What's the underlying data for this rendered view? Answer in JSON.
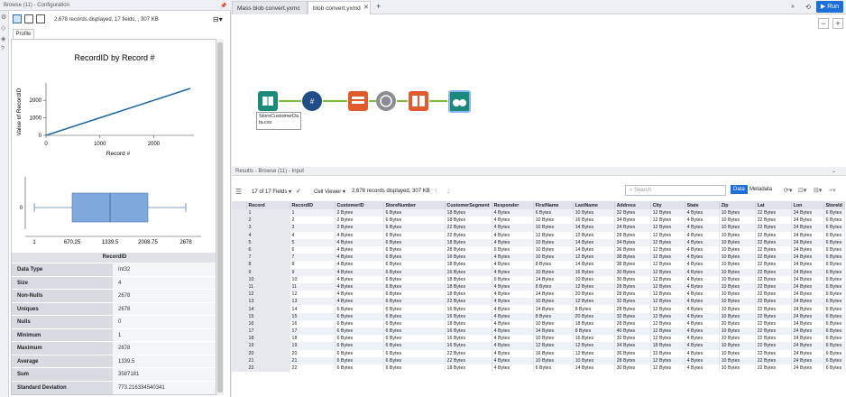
{
  "left_panel": {
    "header": "Browse (11) - Configuration",
    "record_info": "2,678 records displayed, 17 fields, , 307 KB",
    "profile_tab": "Profile",
    "chart_title": "RecordID by Record #",
    "stats_title": "RecordID",
    "stats": [
      {
        "k": "Data Type",
        "v": "Int32"
      },
      {
        "k": "Size",
        "v": "4"
      },
      {
        "k": "Non-Nulls",
        "v": "2678"
      },
      {
        "k": "Uniques",
        "v": "2678"
      },
      {
        "k": "Nulls",
        "v": "0"
      },
      {
        "k": "Minimum",
        "v": "1"
      },
      {
        "k": "Maximum",
        "v": "2678"
      },
      {
        "k": "Average",
        "v": "1339.5"
      },
      {
        "k": "Sum",
        "v": "3587181"
      },
      {
        "k": "Standard Deviation",
        "v": "773.216334540341"
      }
    ]
  },
  "chart_data": [
    {
      "type": "line",
      "title": "RecordID by Record #",
      "xlabel": "Record #",
      "ylabel": "Value of RecordID",
      "x": [
        0,
        2678
      ],
      "y": [
        0,
        2678
      ],
      "xlim": [
        0,
        2678
      ],
      "ylim": [
        0,
        2678
      ],
      "xticks": [
        "0",
        "1000",
        "2000"
      ],
      "yticks": [
        "0",
        "1000",
        "2000"
      ]
    },
    {
      "type": "box",
      "min": 1,
      "q1": 670.25,
      "median": 1339.5,
      "q3": 2008.75,
      "max": 2678,
      "xticks": [
        "1",
        "670.25",
        "1339.5",
        "2008.75",
        "2678"
      ],
      "yticks": [
        "0"
      ]
    }
  ],
  "tabs": [
    {
      "label": "Mass blob convert.yxmc"
    },
    {
      "label": "blob convert.yxmd"
    }
  ],
  "run_label": "Run",
  "tool_annotation": "StoreCustomerDa\nta.csv",
  "results": {
    "header": "Results - Browse (11) - Input",
    "fields_count": "17 of 17 Fields",
    "cell_viewer": "Cell Viewer",
    "records_info": "2,678 records displayed, 307 KB",
    "search_placeholder": "Search",
    "data_btn": "Data",
    "metadata_btn": "Metadata",
    "columns": [
      "Record",
      "RecordID",
      "CustomerID",
      "StoreNumber",
      "CustomerSegment",
      "Responder",
      "FirstName",
      "LastName",
      "Address",
      "City",
      "State",
      "Zip",
      "Lat",
      "Lon",
      "StoreId"
    ],
    "rows": [
      [
        "1",
        "1",
        "2 Bytes",
        "6 Bytes",
        "18 Bytes",
        "4 Bytes",
        "6 Bytes",
        "10 Bytes",
        "32 Bytes",
        "12 Bytes",
        "4 Bytes",
        "10 Bytes",
        "22 Bytes",
        "24 Bytes",
        "6 Bytes"
      ],
      [
        "2",
        "2",
        "2 Bytes",
        "6 Bytes",
        "18 Bytes",
        "4 Bytes",
        "10 Bytes",
        "16 Bytes",
        "34 Bytes",
        "12 Bytes",
        "4 Bytes",
        "10 Bytes",
        "22 Bytes",
        "24 Bytes",
        "6 Bytes"
      ],
      [
        "3",
        "3",
        "2 Bytes",
        "6 Bytes",
        "22 Bytes",
        "4 Bytes",
        "10 Bytes",
        "14 Bytes",
        "24 Bytes",
        "12 Bytes",
        "4 Bytes",
        "10 Bytes",
        "22 Bytes",
        "24 Bytes",
        "6 Bytes"
      ],
      [
        "4",
        "4",
        "4 Bytes",
        "6 Bytes",
        "22 Bytes",
        "4 Bytes",
        "12 Bytes",
        "12 Bytes",
        "28 Bytes",
        "12 Bytes",
        "4 Bytes",
        "10 Bytes",
        "22 Bytes",
        "24 Bytes",
        "6 Bytes"
      ],
      [
        "5",
        "5",
        "4 Bytes",
        "6 Bytes",
        "18 Bytes",
        "4 Bytes",
        "10 Bytes",
        "14 Bytes",
        "34 Bytes",
        "12 Bytes",
        "4 Bytes",
        "10 Bytes",
        "22 Bytes",
        "24 Bytes",
        "6 Bytes"
      ],
      [
        "6",
        "6",
        "4 Bytes",
        "6 Bytes",
        "28 Bytes",
        "6 Bytes",
        "10 Bytes",
        "14 Bytes",
        "36 Bytes",
        "12 Bytes",
        "4 Bytes",
        "10 Bytes",
        "22 Bytes",
        "24 Bytes",
        "6 Bytes"
      ],
      [
        "7",
        "7",
        "4 Bytes",
        "6 Bytes",
        "16 Bytes",
        "4 Bytes",
        "10 Bytes",
        "12 Bytes",
        "38 Bytes",
        "12 Bytes",
        "4 Bytes",
        "10 Bytes",
        "22 Bytes",
        "24 Bytes",
        "6 Bytes"
      ],
      [
        "8",
        "8",
        "4 Bytes",
        "6 Bytes",
        "18 Bytes",
        "4 Bytes",
        "8 Bytes",
        "14 Bytes",
        "38 Bytes",
        "12 Bytes",
        "4 Bytes",
        "10 Bytes",
        "22 Bytes",
        "24 Bytes",
        "6 Bytes"
      ],
      [
        "9",
        "9",
        "4 Bytes",
        "6 Bytes",
        "16 Bytes",
        "4 Bytes",
        "10 Bytes",
        "16 Bytes",
        "30 Bytes",
        "12 Bytes",
        "4 Bytes",
        "10 Bytes",
        "22 Bytes",
        "24 Bytes",
        "6 Bytes"
      ],
      [
        "10",
        "10",
        "4 Bytes",
        "6 Bytes",
        "18 Bytes",
        "6 Bytes",
        "14 Bytes",
        "10 Bytes",
        "30 Bytes",
        "12 Bytes",
        "4 Bytes",
        "10 Bytes",
        "22 Bytes",
        "24 Bytes",
        "6 Bytes"
      ],
      [
        "11",
        "11",
        "4 Bytes",
        "6 Bytes",
        "18 Bytes",
        "4 Bytes",
        "8 Bytes",
        "12 Bytes",
        "28 Bytes",
        "12 Bytes",
        "4 Bytes",
        "10 Bytes",
        "22 Bytes",
        "24 Bytes",
        "6 Bytes"
      ],
      [
        "12",
        "12",
        "4 Bytes",
        "6 Bytes",
        "18 Bytes",
        "4 Bytes",
        "14 Bytes",
        "20 Bytes",
        "28 Bytes",
        "12 Bytes",
        "4 Bytes",
        "10 Bytes",
        "22 Bytes",
        "24 Bytes",
        "6 Bytes"
      ],
      [
        "13",
        "13",
        "4 Bytes",
        "6 Bytes",
        "22 Bytes",
        "4 Bytes",
        "10 Bytes",
        "12 Bytes",
        "32 Bytes",
        "12 Bytes",
        "4 Bytes",
        "10 Bytes",
        "22 Bytes",
        "24 Bytes",
        "6 Bytes"
      ],
      [
        "14",
        "14",
        "6 Bytes",
        "6 Bytes",
        "16 Bytes",
        "4 Bytes",
        "14 Bytes",
        "8 Bytes",
        "28 Bytes",
        "12 Bytes",
        "4 Bytes",
        "10 Bytes",
        "22 Bytes",
        "24 Bytes",
        "6 Bytes"
      ],
      [
        "15",
        "15",
        "6 Bytes",
        "6 Bytes",
        "16 Bytes",
        "4 Bytes",
        "8 Bytes",
        "20 Bytes",
        "32 Bytes",
        "12 Bytes",
        "4 Bytes",
        "10 Bytes",
        "22 Bytes",
        "24 Bytes",
        "6 Bytes"
      ],
      [
        "16",
        "16",
        "6 Bytes",
        "6 Bytes",
        "18 Bytes",
        "4 Bytes",
        "10 Bytes",
        "18 Bytes",
        "28 Bytes",
        "12 Bytes",
        "4 Bytes",
        "20 Bytes",
        "22 Bytes",
        "24 Bytes",
        "6 Bytes"
      ],
      [
        "17",
        "17",
        "6 Bytes",
        "6 Bytes",
        "16 Bytes",
        "4 Bytes",
        "14 Bytes",
        "8 Bytes",
        "40 Bytes",
        "12 Bytes",
        "4 Bytes",
        "10 Bytes",
        "22 Bytes",
        "24 Bytes",
        "6 Bytes"
      ],
      [
        "18",
        "18",
        "6 Bytes",
        "6 Bytes",
        "16 Bytes",
        "4 Bytes",
        "10 Bytes",
        "16 Bytes",
        "32 Bytes",
        "12 Bytes",
        "4 Bytes",
        "10 Bytes",
        "22 Bytes",
        "24 Bytes",
        "6 Bytes"
      ],
      [
        "19",
        "19",
        "6 Bytes",
        "6 Bytes",
        "16 Bytes",
        "4 Bytes",
        "12 Bytes",
        "12 Bytes",
        "34 Bytes",
        "18 Bytes",
        "4 Bytes",
        "10 Bytes",
        "22 Bytes",
        "24 Bytes",
        "6 Bytes"
      ],
      [
        "20",
        "20",
        "6 Bytes",
        "6 Bytes",
        "22 Bytes",
        "4 Bytes",
        "16 Bytes",
        "12 Bytes",
        "36 Bytes",
        "12 Bytes",
        "4 Bytes",
        "10 Bytes",
        "22 Bytes",
        "24 Bytes",
        "6 Bytes"
      ],
      [
        "21",
        "21",
        "6 Bytes",
        "6 Bytes",
        "22 Bytes",
        "4 Bytes",
        "10 Bytes",
        "10 Bytes",
        "28 Bytes",
        "12 Bytes",
        "4 Bytes",
        "10 Bytes",
        "22 Bytes",
        "24 Bytes",
        "6 Bytes"
      ],
      [
        "22",
        "22",
        "6 Bytes",
        "6 Bytes",
        "18 Bytes",
        "4 Bytes",
        "6 Bytes",
        "14 Bytes",
        "30 Bytes",
        "12 Bytes",
        "4 Bytes",
        "10 Bytes",
        "22 Bytes",
        "24 Bytes",
        "6 Bytes"
      ]
    ]
  },
  "colors": {
    "accent": "#1e6fd9",
    "line": "#1f6aa5",
    "box": "#7fa9dc",
    "connector": "#7dbb3c"
  }
}
